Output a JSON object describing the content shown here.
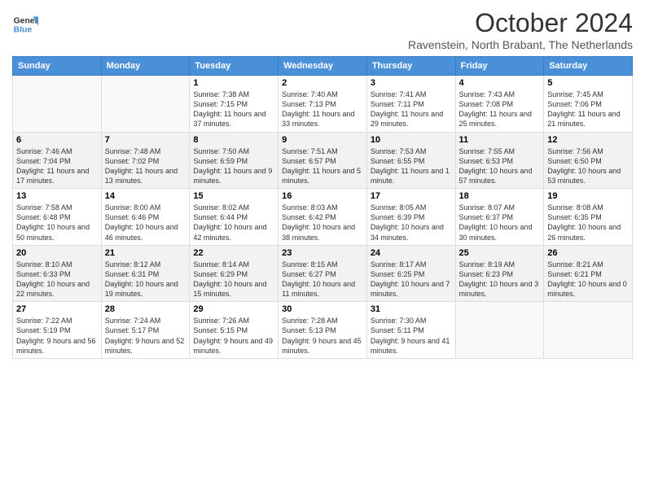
{
  "logo": {
    "line1": "General",
    "line2": "Blue"
  },
  "title": "October 2024",
  "subtitle": "Ravenstein, North Brabant, The Netherlands",
  "days_of_week": [
    "Sunday",
    "Monday",
    "Tuesday",
    "Wednesday",
    "Thursday",
    "Friday",
    "Saturday"
  ],
  "weeks": [
    [
      {
        "day": "",
        "info": ""
      },
      {
        "day": "",
        "info": ""
      },
      {
        "day": "1",
        "info": "Sunrise: 7:38 AM\nSunset: 7:15 PM\nDaylight: 11 hours and 37 minutes."
      },
      {
        "day": "2",
        "info": "Sunrise: 7:40 AM\nSunset: 7:13 PM\nDaylight: 11 hours and 33 minutes."
      },
      {
        "day": "3",
        "info": "Sunrise: 7:41 AM\nSunset: 7:11 PM\nDaylight: 11 hours and 29 minutes."
      },
      {
        "day": "4",
        "info": "Sunrise: 7:43 AM\nSunset: 7:08 PM\nDaylight: 11 hours and 25 minutes."
      },
      {
        "day": "5",
        "info": "Sunrise: 7:45 AM\nSunset: 7:06 PM\nDaylight: 11 hours and 21 minutes."
      }
    ],
    [
      {
        "day": "6",
        "info": "Sunrise: 7:46 AM\nSunset: 7:04 PM\nDaylight: 11 hours and 17 minutes."
      },
      {
        "day": "7",
        "info": "Sunrise: 7:48 AM\nSunset: 7:02 PM\nDaylight: 11 hours and 13 minutes."
      },
      {
        "day": "8",
        "info": "Sunrise: 7:50 AM\nSunset: 6:59 PM\nDaylight: 11 hours and 9 minutes."
      },
      {
        "day": "9",
        "info": "Sunrise: 7:51 AM\nSunset: 6:57 PM\nDaylight: 11 hours and 5 minutes."
      },
      {
        "day": "10",
        "info": "Sunrise: 7:53 AM\nSunset: 6:55 PM\nDaylight: 11 hours and 1 minute."
      },
      {
        "day": "11",
        "info": "Sunrise: 7:55 AM\nSunset: 6:53 PM\nDaylight: 10 hours and 57 minutes."
      },
      {
        "day": "12",
        "info": "Sunrise: 7:56 AM\nSunset: 6:50 PM\nDaylight: 10 hours and 53 minutes."
      }
    ],
    [
      {
        "day": "13",
        "info": "Sunrise: 7:58 AM\nSunset: 6:48 PM\nDaylight: 10 hours and 50 minutes."
      },
      {
        "day": "14",
        "info": "Sunrise: 8:00 AM\nSunset: 6:46 PM\nDaylight: 10 hours and 46 minutes."
      },
      {
        "day": "15",
        "info": "Sunrise: 8:02 AM\nSunset: 6:44 PM\nDaylight: 10 hours and 42 minutes."
      },
      {
        "day": "16",
        "info": "Sunrise: 8:03 AM\nSunset: 6:42 PM\nDaylight: 10 hours and 38 minutes."
      },
      {
        "day": "17",
        "info": "Sunrise: 8:05 AM\nSunset: 6:39 PM\nDaylight: 10 hours and 34 minutes."
      },
      {
        "day": "18",
        "info": "Sunrise: 8:07 AM\nSunset: 6:37 PM\nDaylight: 10 hours and 30 minutes."
      },
      {
        "day": "19",
        "info": "Sunrise: 8:08 AM\nSunset: 6:35 PM\nDaylight: 10 hours and 26 minutes."
      }
    ],
    [
      {
        "day": "20",
        "info": "Sunrise: 8:10 AM\nSunset: 6:33 PM\nDaylight: 10 hours and 22 minutes."
      },
      {
        "day": "21",
        "info": "Sunrise: 8:12 AM\nSunset: 6:31 PM\nDaylight: 10 hours and 19 minutes."
      },
      {
        "day": "22",
        "info": "Sunrise: 8:14 AM\nSunset: 6:29 PM\nDaylight: 10 hours and 15 minutes."
      },
      {
        "day": "23",
        "info": "Sunrise: 8:15 AM\nSunset: 6:27 PM\nDaylight: 10 hours and 11 minutes."
      },
      {
        "day": "24",
        "info": "Sunrise: 8:17 AM\nSunset: 6:25 PM\nDaylight: 10 hours and 7 minutes."
      },
      {
        "day": "25",
        "info": "Sunrise: 8:19 AM\nSunset: 6:23 PM\nDaylight: 10 hours and 3 minutes."
      },
      {
        "day": "26",
        "info": "Sunrise: 8:21 AM\nSunset: 6:21 PM\nDaylight: 10 hours and 0 minutes."
      }
    ],
    [
      {
        "day": "27",
        "info": "Sunrise: 7:22 AM\nSunset: 5:19 PM\nDaylight: 9 hours and 56 minutes."
      },
      {
        "day": "28",
        "info": "Sunrise: 7:24 AM\nSunset: 5:17 PM\nDaylight: 9 hours and 52 minutes."
      },
      {
        "day": "29",
        "info": "Sunrise: 7:26 AM\nSunset: 5:15 PM\nDaylight: 9 hours and 49 minutes."
      },
      {
        "day": "30",
        "info": "Sunrise: 7:28 AM\nSunset: 5:13 PM\nDaylight: 9 hours and 45 minutes."
      },
      {
        "day": "31",
        "info": "Sunrise: 7:30 AM\nSunset: 5:11 PM\nDaylight: 9 hours and 41 minutes."
      },
      {
        "day": "",
        "info": ""
      },
      {
        "day": "",
        "info": ""
      }
    ]
  ]
}
